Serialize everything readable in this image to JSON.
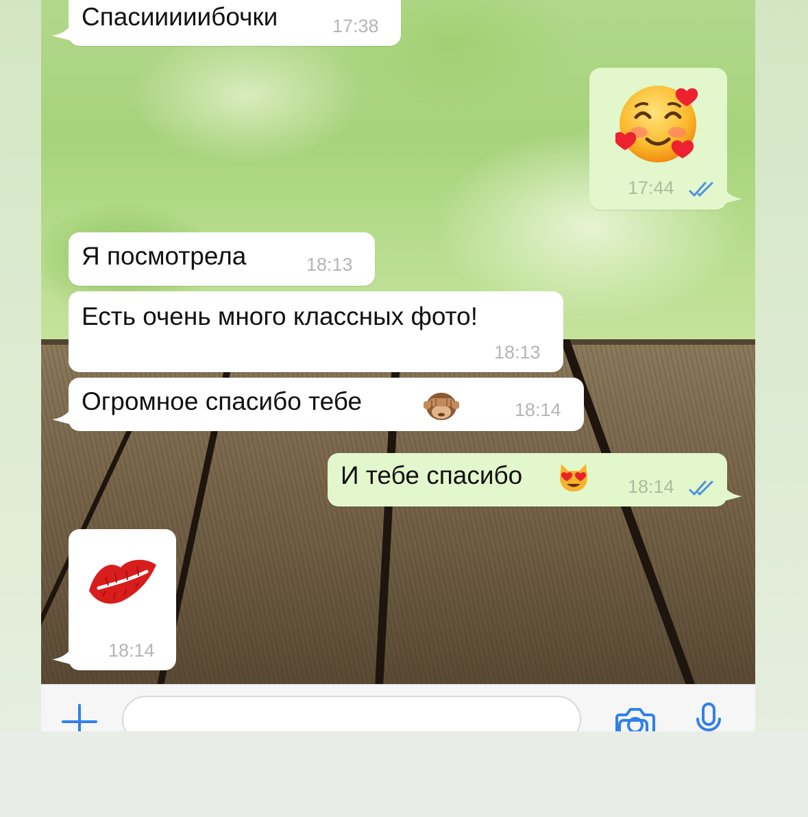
{
  "chat": {
    "messages": [
      {
        "id": "m1",
        "direction": "incoming",
        "text": "Спасииииибочки",
        "time": "17:38"
      },
      {
        "id": "m2",
        "direction": "outgoing",
        "emoji": "smiling-face-with-hearts",
        "time": "17:44",
        "read": true
      },
      {
        "id": "m3",
        "direction": "incoming",
        "text": "Я посмотрела",
        "time": "18:13"
      },
      {
        "id": "m4",
        "direction": "incoming",
        "text": "Есть очень много классных фото!",
        "time": "18:13"
      },
      {
        "id": "m5",
        "direction": "incoming",
        "text": "Огромное спасибо тебе",
        "emoji": "see-no-evil-monkey",
        "time": "18:14"
      },
      {
        "id": "m6",
        "direction": "outgoing",
        "text": "И тебе спасибо",
        "emoji": "heart-eyes-cat",
        "time": "18:14",
        "read": true
      },
      {
        "id": "m7",
        "direction": "incoming",
        "emoji": "kiss-mark",
        "time": "18:14"
      }
    ]
  },
  "input_bar": {
    "message_placeholder": "",
    "icons": [
      "plus-icon",
      "sticker-icon",
      "camera-icon",
      "microphone-icon"
    ]
  },
  "colors": {
    "incoming_bubble": "#ffffff",
    "outgoing_bubble": "#e2f7cb",
    "timestamp": "#b5b5b5",
    "read_ticks": "#4a90e2",
    "accent": "#2f80ed"
  }
}
